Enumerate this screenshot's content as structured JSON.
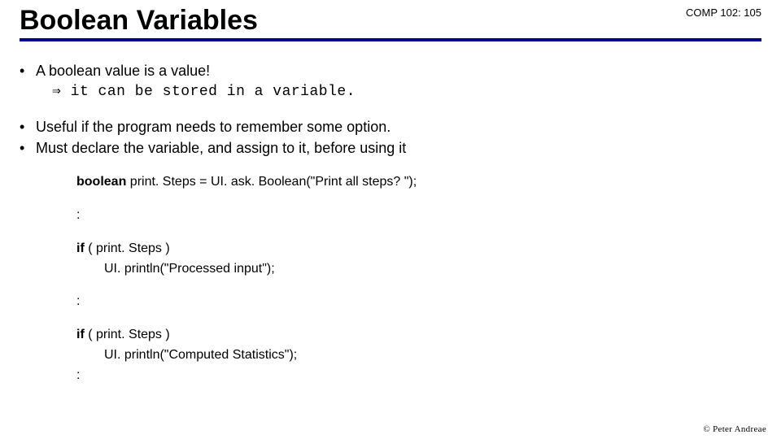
{
  "header": {
    "title": "Boolean Variables",
    "course": "COMP 102: 105"
  },
  "bullets": {
    "b1": "A boolean value is a value!",
    "b1_sub": "⇒ it can be stored in a variable.",
    "b2": "Useful if the program needs to remember some option.",
    "b3": "Must declare the variable, and assign to it, before using it"
  },
  "code": {
    "decl_kw": "boolean",
    "decl_rest": " print. Steps = UI. ask. Boolean(\"Print all steps? \");",
    "colon": ":",
    "if_kw": "if",
    "if1_cond": " ( print. Steps )",
    "if1_body": "UI. println(\"Processed input\");",
    "if2_cond": " ( print. Steps )",
    "if2_body": "UI. println(\"Computed Statistics\");"
  },
  "footer": {
    "text": "© Peter Andreae"
  }
}
